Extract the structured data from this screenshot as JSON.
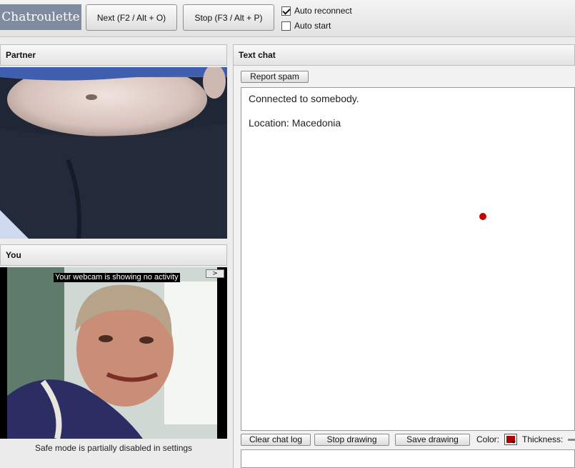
{
  "app": {
    "logo": "Chatroulette"
  },
  "toolbar": {
    "next_label": "Next (F2 / Alt + O)",
    "stop_label": "Stop (F3 / Alt + P)",
    "auto_reconnect": {
      "label": "Auto reconnect",
      "checked": true
    },
    "auto_start": {
      "label": "Auto start",
      "checked": false
    }
  },
  "partner": {
    "title": "Partner"
  },
  "you": {
    "title": "You",
    "webcam_status": "Your webcam is showing no activity",
    "expand_label": ">",
    "safe_mode_note": "Safe mode is partially disabled in settings"
  },
  "chat": {
    "title": "Text chat",
    "report_spam_label": "Report spam",
    "messages": [
      "Connected to somebody.",
      "Location: Macedonia"
    ],
    "clear_log_label": "Clear chat log",
    "stop_drawing_label": "Stop drawing",
    "save_drawing_label": "Save drawing",
    "color_label": "Color:",
    "thickness_label": "Thickness:",
    "draw_color": "#c70000"
  }
}
